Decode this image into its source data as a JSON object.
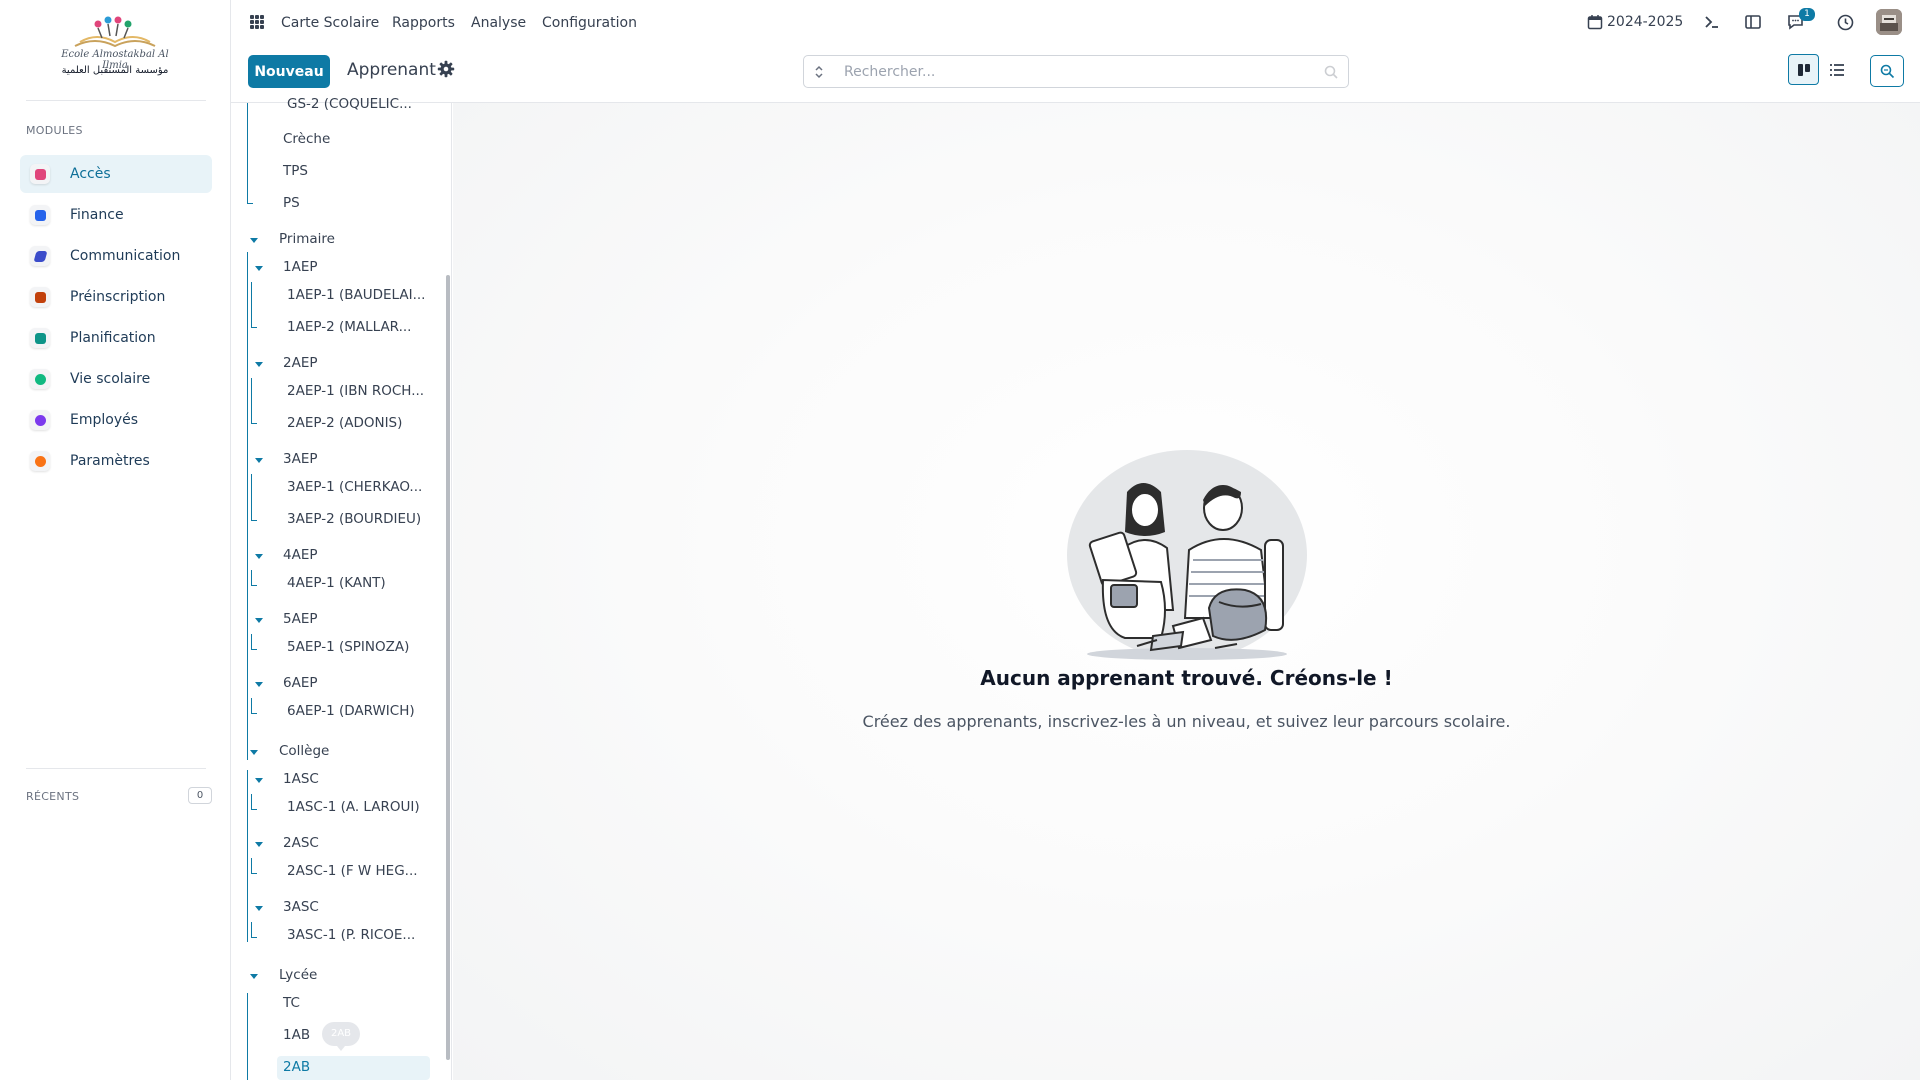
{
  "school": {
    "name_latin": "Ecole Almostakbal Al Ilmia",
    "name_arabic": "مؤسسة المستقبل العلمية"
  },
  "sidebar": {
    "modules_heading": "MODULES",
    "modules": [
      {
        "label": "Accès",
        "icon": "access-icon",
        "color": "#e0457b"
      },
      {
        "label": "Finance",
        "icon": "finance-icon",
        "color": "#2563eb"
      },
      {
        "label": "Communication",
        "icon": "communication-icon",
        "color": "#3b4cca"
      },
      {
        "label": "Préinscription",
        "icon": "preregistration-icon",
        "color": "#c2410c"
      },
      {
        "label": "Planification",
        "icon": "planning-icon",
        "color": "#0d9488"
      },
      {
        "label": "Vie scolaire",
        "icon": "school-life-icon",
        "color": "#10b981"
      },
      {
        "label": "Employés",
        "icon": "employees-icon",
        "color": "#7c3aed"
      },
      {
        "label": "Paramètres",
        "icon": "settings-icon",
        "color": "#f97316"
      }
    ],
    "recents_heading": "RÉCENTS",
    "recents_count": "0"
  },
  "topbar": {
    "menu": [
      "Carte Scolaire",
      "Rapports",
      "Analyse",
      "Configuration"
    ],
    "year": "2024-2025",
    "messages_badge": "1"
  },
  "control": {
    "new_label": "Nouveau",
    "title": "Apprenant",
    "search_placeholder": "Rechercher..."
  },
  "tree": {
    "partial_top": "GS-2 (COQUELIC...",
    "maternelle_children": [
      "Crèche",
      "TPS",
      "PS"
    ],
    "primaire": "Primaire",
    "primaire_levels": [
      {
        "label": "1AEP",
        "classes": [
          "1AEP-1 (BAUDELAI...",
          "1AEP-2 (MALLAR..."
        ]
      },
      {
        "label": "2AEP",
        "classes": [
          "2AEP-1 (IBN ROCH...",
          "2AEP-2 (ADONIS)"
        ]
      },
      {
        "label": "3AEP",
        "classes": [
          "3AEP-1 (CHERKAO...",
          "3AEP-2 (BOURDIEU)"
        ]
      },
      {
        "label": "4AEP",
        "classes": [
          "4AEP-1 (KANT)"
        ]
      },
      {
        "label": "5AEP",
        "classes": [
          "5AEP-1 (SPINOZA)"
        ]
      },
      {
        "label": "6AEP",
        "classes": [
          "6AEP-1 (DARWICH)"
        ]
      }
    ],
    "college": "Collège",
    "college_levels": [
      {
        "label": "1ASC",
        "classes": [
          "1ASC-1 (A. LAROUI)"
        ]
      },
      {
        "label": "2ASC",
        "classes": [
          "2ASC-1 (F W HEG..."
        ]
      },
      {
        "label": "3ASC",
        "classes": [
          "3ASC-1 (P. RICOE..."
        ]
      }
    ],
    "lycee": "Lycée",
    "lycee_children": [
      "TC",
      "1AB",
      "2AB"
    ],
    "tooltip": "2AB"
  },
  "empty_state": {
    "title": "Aucun apprenant trouvé. Créons-le !",
    "subtitle": "Créez des apprenants, inscrivez-les à un niveau, et suivez leur parcours scolaire."
  }
}
